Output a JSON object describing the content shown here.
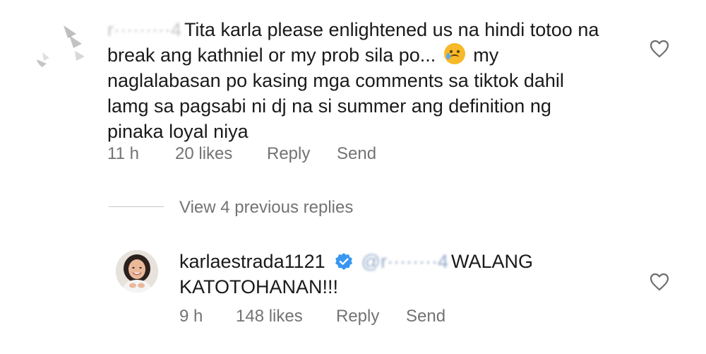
{
  "comments": [
    {
      "username_blurred": "r·········4",
      "text": "Tita karla please enlightened us na hindi totoo na break ang kathniel or my prob sila po...",
      "text_after_emoji": "my naglalabasan po kasing mga comments sa tiktok dahil lamg sa pagsabi ni dj na si summer ang definition ng pinaka loyal niya",
      "emoji": "crying-face",
      "time": "11 h",
      "likes": "20 likes",
      "reply_label": "Reply",
      "send_label": "Send"
    },
    {
      "username": "karlaestrada1121",
      "verified": true,
      "mention_blurred": "@r········4",
      "text": "WALANG KATOTOHANAN!!!",
      "time": "9 h",
      "likes": "148 likes",
      "reply_label": "Reply",
      "send_label": "Send"
    }
  ],
  "view_replies_label": "View 4 previous replies",
  "colors": {
    "text": "#1a1a1a",
    "meta": "#737373",
    "verified": "#3897f0",
    "divider": "#c8c8c8"
  }
}
